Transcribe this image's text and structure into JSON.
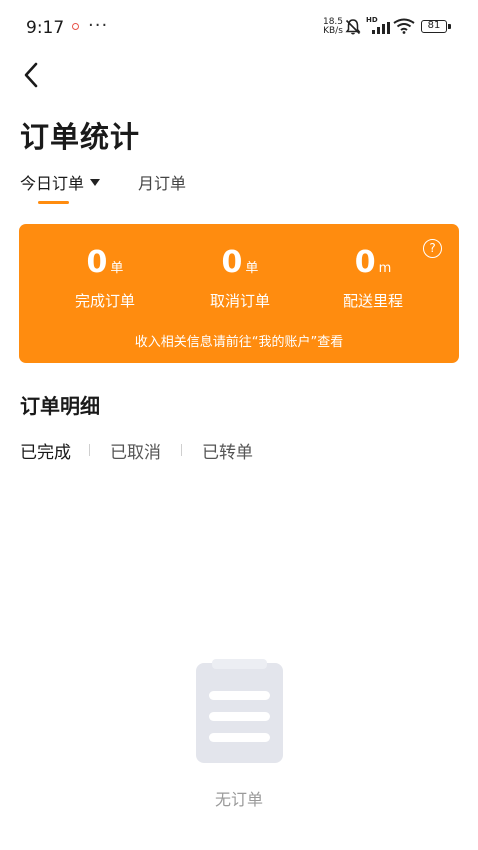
{
  "status_bar": {
    "time": "9:17",
    "more": "···",
    "net_speed_value": "18.5",
    "net_speed_unit": "KB/s",
    "hd_label": "HD",
    "battery": "81"
  },
  "header": {
    "title": "订单统计"
  },
  "tabs": {
    "today": "今日订单",
    "month": "月订单"
  },
  "stats": {
    "completed": {
      "value": "0",
      "unit": "单",
      "label": "完成订单"
    },
    "cancelled": {
      "value": "0",
      "unit": "单",
      "label": "取消订单"
    },
    "distance": {
      "value": "0",
      "unit": "m",
      "label": "配送里程"
    },
    "note": "收入相关信息请前往“我的账户”查看",
    "help_glyph": "?"
  },
  "details": {
    "title": "订单明细",
    "filters": [
      "已完成",
      "已取消",
      "已转单"
    ]
  },
  "empty": {
    "text": "无订单"
  },
  "colors": {
    "accent": "#ff8c0f",
    "empty_icon": "#e3e5ec"
  }
}
